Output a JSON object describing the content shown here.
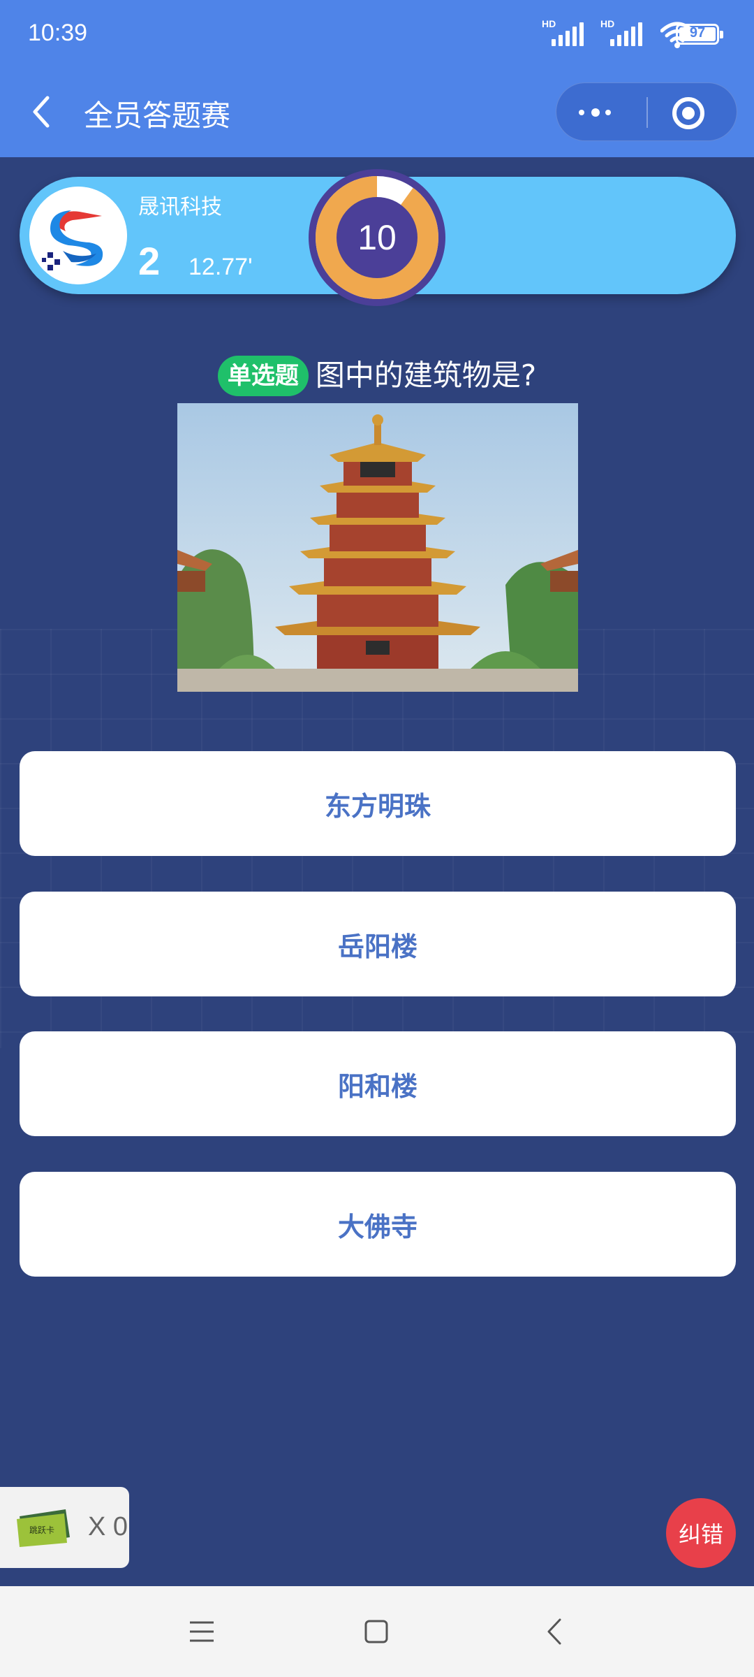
{
  "status_bar": {
    "time": "10:39",
    "hd1": "HD",
    "hd2": "HD",
    "battery": "97"
  },
  "nav": {
    "title": "全员答题赛"
  },
  "player": {
    "team_name": "晟讯科技",
    "rank": "2",
    "time": "12.77'",
    "countdown": "10",
    "countdown_progress": 0.9
  },
  "question": {
    "tag": "单选题",
    "text": "图中的建筑物是?"
  },
  "options": [
    {
      "label": "东方明珠"
    },
    {
      "label": "岳阳楼"
    },
    {
      "label": "阳和楼"
    },
    {
      "label": "大佛寺"
    }
  ],
  "skip_card": {
    "icon_text": "跳跃卡",
    "count": "X 0"
  },
  "correct_button": {
    "label": "纠错"
  },
  "colors": {
    "header": "#4f84e8",
    "background": "#2e427c",
    "player_bar": "#62c5fa",
    "tag_green": "#1fc06a",
    "option_text": "#4a72c5",
    "correct_red": "#e8404a",
    "timer_orange": "#f0a84e",
    "timer_ring": "#4b3f98"
  }
}
